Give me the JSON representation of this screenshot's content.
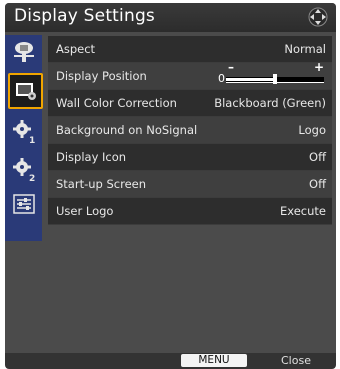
{
  "window": {
    "title": "Display Settings"
  },
  "sidebar": {
    "items": [
      {
        "icon": "projector-image-icon",
        "active": false
      },
      {
        "icon": "display-settings-icon",
        "active": true
      },
      {
        "icon": "gear-1-icon",
        "active": false,
        "badge": "1"
      },
      {
        "icon": "gear-2-icon",
        "active": false,
        "badge": "2"
      },
      {
        "icon": "sliders-icon",
        "active": false
      }
    ]
  },
  "settings": {
    "aspect": {
      "label": "Aspect",
      "value": "Normal"
    },
    "display_position": {
      "label": "Display Position",
      "zero": "0",
      "minus": "–",
      "plus": "+",
      "position": 0.5
    },
    "wall_color": {
      "label": "Wall Color Correction",
      "value": "Blackboard (Green)"
    },
    "background": {
      "label": "Background on NoSignal",
      "value": "Logo"
    },
    "display_icon": {
      "label": "Display Icon",
      "value": "Off"
    },
    "startup": {
      "label": "Start-up Screen",
      "value": "Off"
    },
    "user_logo": {
      "label": "User Logo",
      "value": "Execute"
    }
  },
  "footer": {
    "menu": "MENU",
    "close": "Close"
  },
  "colors": {
    "frame": "#4b4b4b",
    "sidebar": "#2a3a78",
    "accent": "#f0a500"
  }
}
